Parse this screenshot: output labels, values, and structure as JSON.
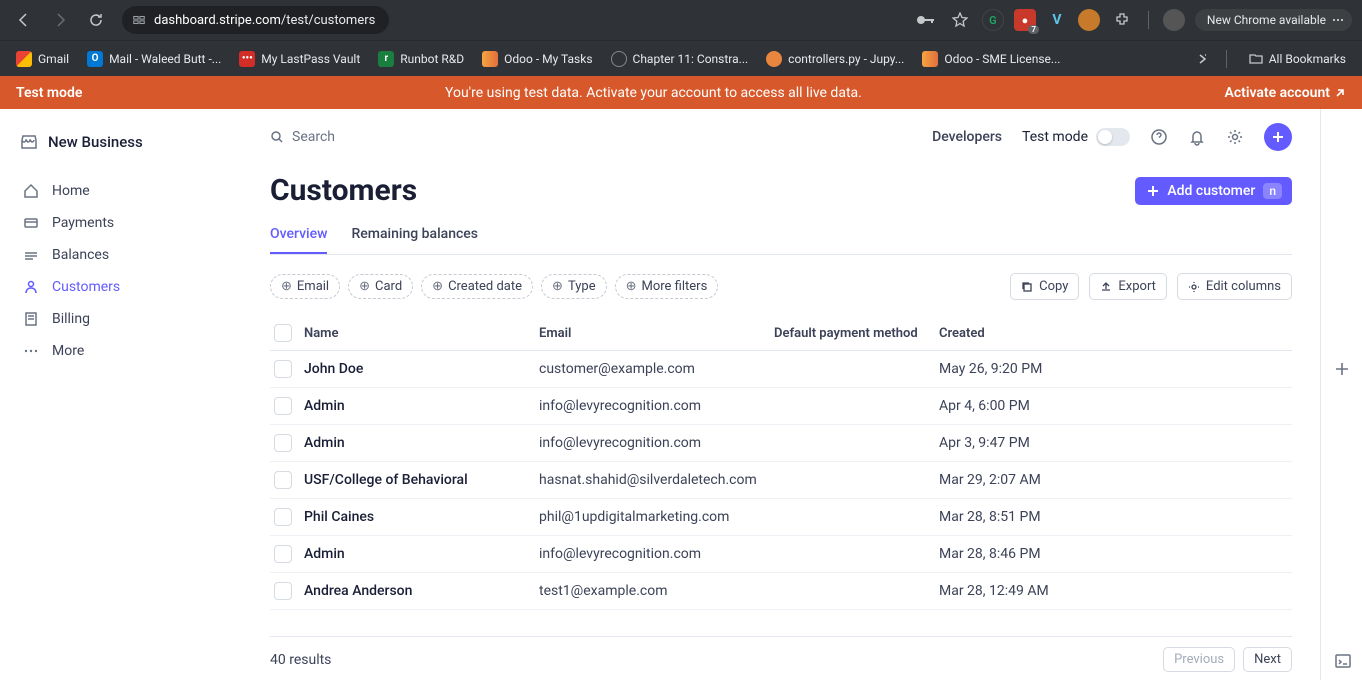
{
  "browser": {
    "url_host": "dashboard.stripe.com",
    "url_path": "/test/customers",
    "new_chrome": "New Chrome available"
  },
  "bookmarks": [
    {
      "label": "Gmail",
      "icon": "gmail"
    },
    {
      "label": "Mail - Waleed Butt -...",
      "icon": "outlook"
    },
    {
      "label": "My LastPass Vault",
      "icon": "lastpass"
    },
    {
      "label": "Runbot R&D",
      "icon": "runbot"
    },
    {
      "label": "Odoo - My Tasks",
      "icon": "odoo"
    },
    {
      "label": "Chapter 11: Constra...",
      "icon": "globe"
    },
    {
      "label": "controllers.py - Jupy...",
      "icon": "jupyter"
    },
    {
      "label": "Odoo - SME License...",
      "icon": "odoo"
    }
  ],
  "all_bookmarks": "All Bookmarks",
  "banner": {
    "left": "Test mode",
    "center": "You're using test data. Activate your account to access all live data.",
    "right": "Activate account"
  },
  "sidebar": {
    "business": "New Business",
    "items": [
      {
        "label": "Home"
      },
      {
        "label": "Payments"
      },
      {
        "label": "Balances"
      },
      {
        "label": "Customers"
      },
      {
        "label": "Billing"
      },
      {
        "label": "More"
      }
    ]
  },
  "topbar": {
    "search": "Search",
    "developers": "Developers",
    "test_mode": "Test mode"
  },
  "page": {
    "title": "Customers",
    "add_btn": "Add customer",
    "kbd": "n"
  },
  "tabs": [
    {
      "label": "Overview",
      "active": true
    },
    {
      "label": "Remaining balances",
      "active": false
    }
  ],
  "filters": [
    "Email",
    "Card",
    "Created date",
    "Type",
    "More filters"
  ],
  "actions": {
    "copy": "Copy",
    "export": "Export",
    "edit": "Edit columns"
  },
  "columns": {
    "name": "Name",
    "email": "Email",
    "payment": "Default payment method",
    "created": "Created"
  },
  "rows": [
    {
      "name": "John Doe",
      "email": "customer@example.com",
      "payment": "",
      "created": "May 26, 9:20 PM"
    },
    {
      "name": "Admin",
      "email": "info@levyrecognition.com",
      "payment": "",
      "created": "Apr 4, 6:00 PM"
    },
    {
      "name": "Admin",
      "email": "info@levyrecognition.com",
      "payment": "",
      "created": "Apr 3, 9:47 PM"
    },
    {
      "name": "USF/College of Behavioral",
      "email": "hasnat.shahid@silverdaletech.com",
      "payment": "",
      "created": "Mar 29, 2:07 AM"
    },
    {
      "name": "Phil Caines",
      "email": "phil@1updigitalmarketing.com",
      "payment": "",
      "created": "Mar 28, 8:51 PM"
    },
    {
      "name": "Admin",
      "email": "info@levyrecognition.com",
      "payment": "",
      "created": "Mar 28, 8:46 PM"
    },
    {
      "name": "Andrea Anderson",
      "email": "test1@example.com",
      "payment": "",
      "created": "Mar 28, 12:49 AM"
    }
  ],
  "footer": {
    "results": "40 results",
    "prev": "Previous",
    "next": "Next"
  }
}
